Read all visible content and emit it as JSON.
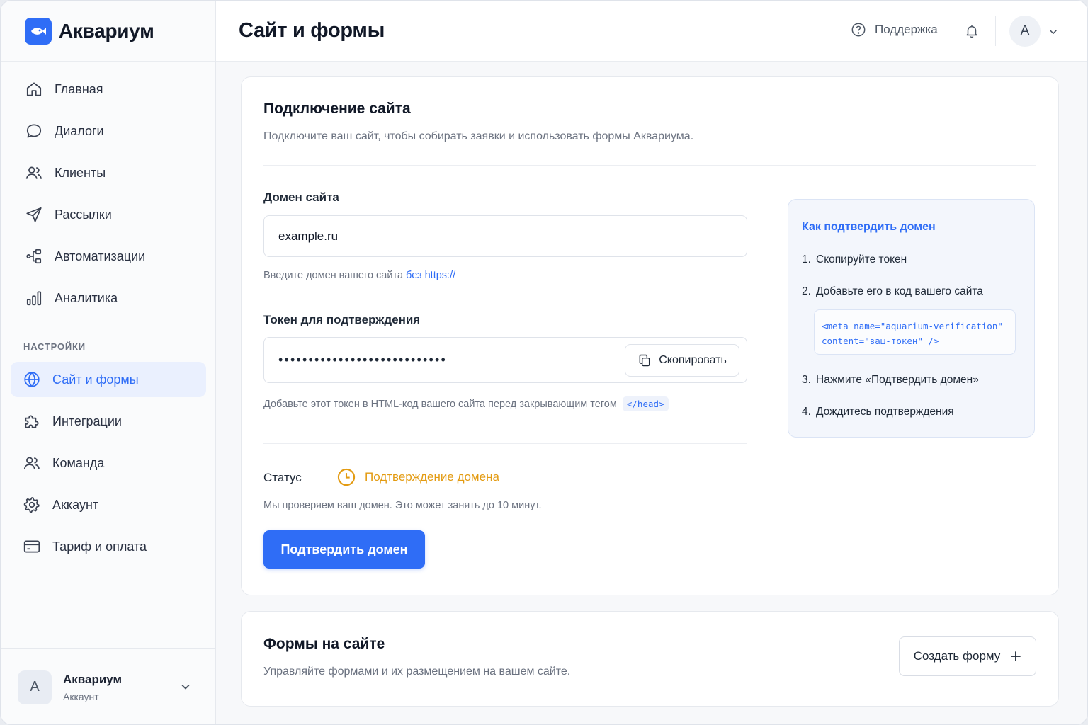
{
  "app": {
    "name": "Аквариум"
  },
  "header": {
    "title": "Сайт и формы",
    "support_label": "Поддержка",
    "avatar_initial": "А"
  },
  "sidebar": {
    "items": [
      {
        "label": "Главная",
        "icon": "home-icon"
      },
      {
        "label": "Диалоги",
        "icon": "chat-icon"
      },
      {
        "label": "Клиенты",
        "icon": "users-icon"
      },
      {
        "label": "Рассылки",
        "icon": "send-icon"
      },
      {
        "label": "Автоматизации",
        "icon": "workflow-icon"
      },
      {
        "label": "Аналитика",
        "icon": "bar-chart-icon"
      }
    ],
    "section_label": "НАСТРОЙКИ",
    "settings_items": [
      {
        "label": "Сайт и формы",
        "icon": "globe-icon",
        "active": true
      },
      {
        "label": "Интеграции",
        "icon": "puzzle-icon"
      },
      {
        "label": "Команда",
        "icon": "team-icon"
      },
      {
        "label": "Аккаунт",
        "icon": "gear-icon"
      },
      {
        "label": "Тариф и оплата",
        "icon": "credit-card-icon"
      }
    ],
    "account": {
      "initial": "А",
      "name": "Аквариум",
      "subtitle": "Аккаунт"
    }
  },
  "connect": {
    "title": "Подключение сайта",
    "description": "Подключите ваш сайт, чтобы собирать заявки и использовать формы Аквариума.",
    "domain_label": "Домен сайта",
    "domain_value": "example.ru",
    "domain_hint": "Введите домен вашего сайта",
    "domain_hint_link": "без https://",
    "token_label": "Токен для подтверждения",
    "token_value": "••••••••••••••••••••••••••••",
    "copy_label": "Скопировать",
    "token_hint": "Добавьте этот токен в HTML-код вашего сайта перед закрывающим тегом",
    "token_hint_code": "</head>",
    "status_label": "Статус",
    "status_value": "Подтверждение домена",
    "status_note": "Мы проверяем ваш домен. Это может занять до 10 минут.",
    "confirm_button": "Подтвердить домен"
  },
  "instructions": {
    "title": "Как подтвердить домен",
    "steps": [
      {
        "num": "1.",
        "text": "Скопируйте токен"
      },
      {
        "num": "2.",
        "text": "Добавьте его в код вашего сайта"
      },
      {
        "num": "3.",
        "text": "Нажмите «Подтвердить домен»"
      },
      {
        "num": "4.",
        "text": "Дождитесь подтверждения"
      }
    ],
    "code": "<meta name=\"aquarium-verification\"\ncontent=\"ваш-токен\" />"
  },
  "forms": {
    "title": "Формы на сайте",
    "description": "Управляйте формами и их размещением на вашем сайте.",
    "create_button": "Создать форму"
  },
  "colors": {
    "accent": "#2f6df6",
    "warning": "#e39b12",
    "active_bg": "#eaf0fe"
  }
}
